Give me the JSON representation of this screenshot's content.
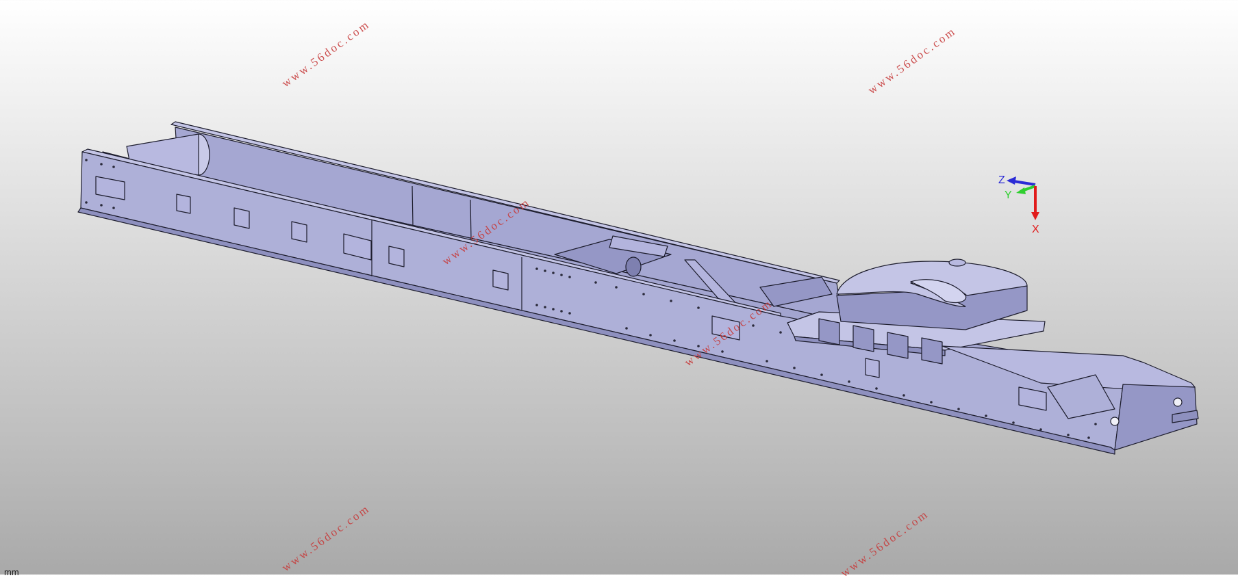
{
  "viewport": {
    "units_label": "mm"
  },
  "watermark": {
    "text": "www.56doc.com",
    "color": "#c73b3b"
  },
  "compass": {
    "x_label": "X",
    "y_label": "Y",
    "z_label": "Z",
    "x_color": "#e11b1b",
    "y_color": "#2fcf2f",
    "z_color": "#2b2bd6"
  },
  "model": {
    "fill": "#aeb0d8",
    "fill_light": "#c4c5e6",
    "fill_dark": "#8e90bf",
    "edge": "#1c1c2c"
  }
}
